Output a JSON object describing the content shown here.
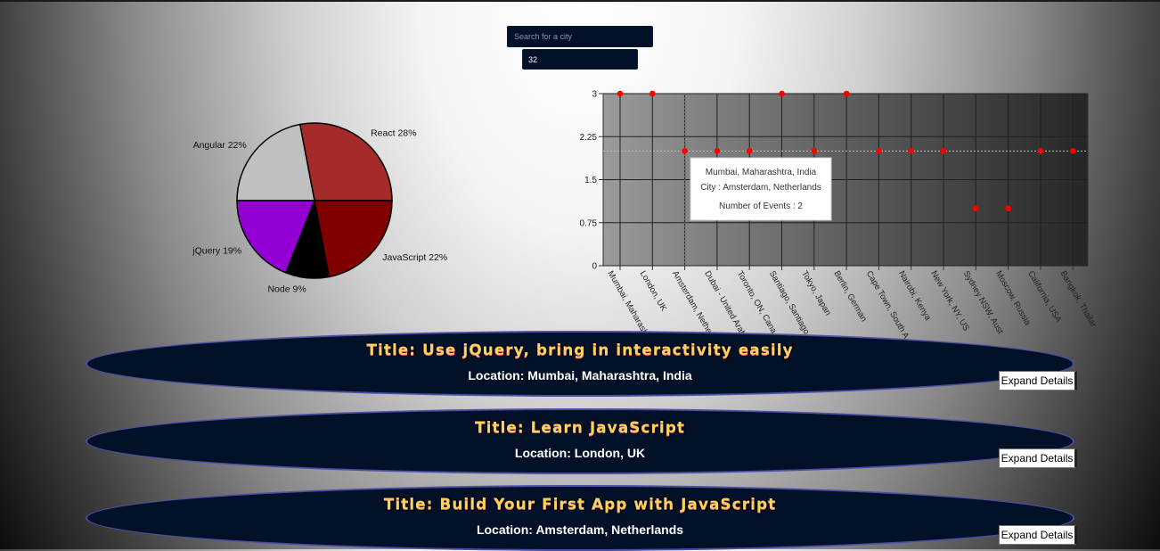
{
  "search": {
    "placeholder": "Search for a city",
    "value": ""
  },
  "number_input": {
    "value": "32"
  },
  "chart_data": [
    {
      "type": "pie",
      "title": "",
      "slices": [
        {
          "label": "React 28%",
          "value": 28,
          "color": "#a52a2a"
        },
        {
          "label": "Angular 22%",
          "value": 22,
          "color": "#c0c0c0"
        },
        {
          "label": "jQuery 19%",
          "value": 19,
          "color": "#9400d3"
        },
        {
          "label": "Node 9%",
          "value": 9,
          "color": "#000000"
        },
        {
          "label": "JavaScript 22%",
          "value": 22,
          "color": "#800000"
        }
      ]
    },
    {
      "type": "scatter",
      "title": "",
      "xlabel": "",
      "ylabel": "",
      "ylim": [
        0,
        3
      ],
      "yticks": [
        "0",
        "0.75",
        "1.5",
        "2.25",
        "3"
      ],
      "grid": true,
      "legend": "none",
      "point_color": "#ff0000",
      "categories": [
        "Mumbai, Maharashtra",
        "London, UK",
        "Amsterdam, Netherl",
        "Dubai - United Arab E",
        "Toronto, ON, Cana",
        "Santiago, Santiago Metropolita",
        "Tokyo, Japan",
        "Berlin, German",
        "Cape Town, South A",
        "Nairobi, Kenya",
        "New York, NY, US",
        "Sydney NSW, Aust",
        "Moscow, Russia",
        "California, USA",
        "Bangkok, Thailar"
      ],
      "values": [
        3,
        3,
        2,
        2,
        2,
        3,
        2,
        3,
        2,
        2,
        2,
        1,
        1,
        2,
        2
      ],
      "tooltip": {
        "title": "Mumbai, Maharashtra, India",
        "line1": "City : Amsterdam, Netherlands",
        "line2": "Number of Events : 2",
        "category_index": 2
      }
    }
  ],
  "events": [
    {
      "title": "Title: Use jQuery, bring in interactivity easily",
      "location": "Location: Mumbai, Maharashtra, India",
      "button": "Expand Details"
    },
    {
      "title": "Title: Learn JavaScript",
      "location": "Location: London, UK",
      "button": "Expand Details"
    },
    {
      "title": "Title: Build Your First App with JavaScript",
      "location": "Location: Amsterdam, Netherlands",
      "button": "Expand Details"
    }
  ]
}
